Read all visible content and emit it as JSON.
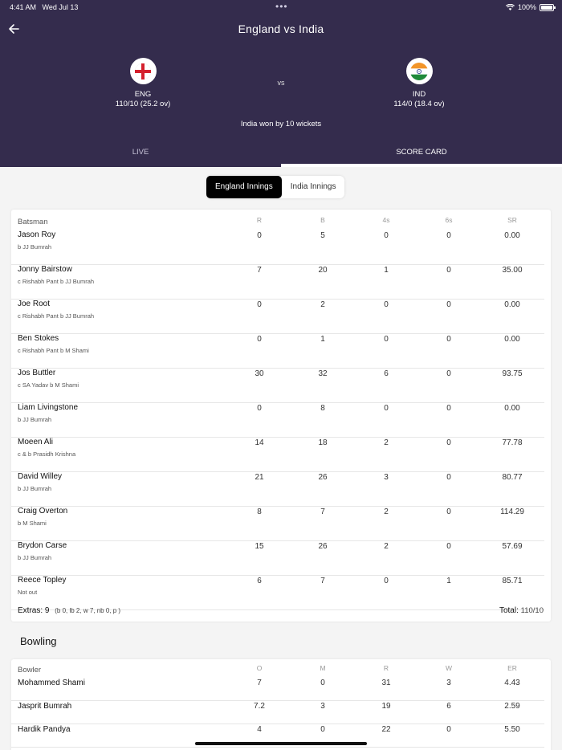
{
  "status": {
    "time": "4:41 AM",
    "date": "Wed Jul 13",
    "battery": "100%"
  },
  "header": {
    "title": "England vs India",
    "vs": "vs",
    "team1": {
      "code": "ENG",
      "score": "110/10 (25.2 ov)"
    },
    "team2": {
      "code": "IND",
      "score": "114/0 (18.4 ov)"
    },
    "result": "India won by 10 wickets"
  },
  "tabs": {
    "live": "LIVE",
    "scorecard": "SCORE CARD"
  },
  "innings_toggle": {
    "active": "England Innings",
    "inactive": "India Innings"
  },
  "batting": {
    "headers": [
      "Batsman",
      "R",
      "B",
      "4s",
      "6s",
      "SR"
    ],
    "rows": [
      {
        "name": "Jason Roy",
        "dismissal": "b JJ Bumrah",
        "r": "0",
        "b": "5",
        "fours": "0",
        "sixes": "0",
        "sr": "0.00"
      },
      {
        "name": "Jonny Bairstow",
        "dismissal": "c Rishabh Pant b JJ Bumrah",
        "r": "7",
        "b": "20",
        "fours": "1",
        "sixes": "0",
        "sr": "35.00"
      },
      {
        "name": "Joe Root",
        "dismissal": "c Rishabh Pant b JJ Bumrah",
        "r": "0",
        "b": "2",
        "fours": "0",
        "sixes": "0",
        "sr": "0.00"
      },
      {
        "name": "Ben Stokes",
        "dismissal": "c Rishabh Pant b M Shami",
        "r": "0",
        "b": "1",
        "fours": "0",
        "sixes": "0",
        "sr": "0.00"
      },
      {
        "name": "Jos Buttler",
        "dismissal": "c SA Yadav b M Shami",
        "r": "30",
        "b": "32",
        "fours": "6",
        "sixes": "0",
        "sr": "93.75"
      },
      {
        "name": "Liam Livingstone",
        "dismissal": "b JJ Bumrah",
        "r": "0",
        "b": "8",
        "fours": "0",
        "sixes": "0",
        "sr": "0.00"
      },
      {
        "name": "Moeen Ali",
        "dismissal": "c & b Prasidh Krishna",
        "r": "14",
        "b": "18",
        "fours": "2",
        "sixes": "0",
        "sr": "77.78"
      },
      {
        "name": "David Willey",
        "dismissal": "b JJ Bumrah",
        "r": "21",
        "b": "26",
        "fours": "3",
        "sixes": "0",
        "sr": "80.77"
      },
      {
        "name": "Craig Overton",
        "dismissal": "b M Shami",
        "r": "8",
        "b": "7",
        "fours": "2",
        "sixes": "0",
        "sr": "114.29"
      },
      {
        "name": "Brydon Carse",
        "dismissal": "b JJ Bumrah",
        "r": "15",
        "b": "26",
        "fours": "2",
        "sixes": "0",
        "sr": "57.69"
      },
      {
        "name": "Reece Topley",
        "dismissal": "Not out",
        "r": "6",
        "b": "7",
        "fours": "0",
        "sixes": "1",
        "sr": "85.71"
      }
    ],
    "extras_label": "Extras: 9",
    "extras_detail": "(b 0, lb 2, w 7, nb 0, p )",
    "total_label": "Total:",
    "total_value": "110/10"
  },
  "bowling": {
    "title": "Bowling",
    "headers": [
      "Bowler",
      "O",
      "M",
      "R",
      "W",
      "ER"
    ],
    "rows": [
      {
        "name": "Mohammed Shami",
        "o": "7",
        "m": "0",
        "r": "31",
        "w": "3",
        "er": "4.43"
      },
      {
        "name": "Jasprit Bumrah",
        "o": "7.2",
        "m": "3",
        "r": "19",
        "w": "6",
        "er": "2.59"
      },
      {
        "name": "Hardik Pandya",
        "o": "4",
        "m": "0",
        "r": "22",
        "w": "0",
        "er": "5.50"
      }
    ]
  }
}
